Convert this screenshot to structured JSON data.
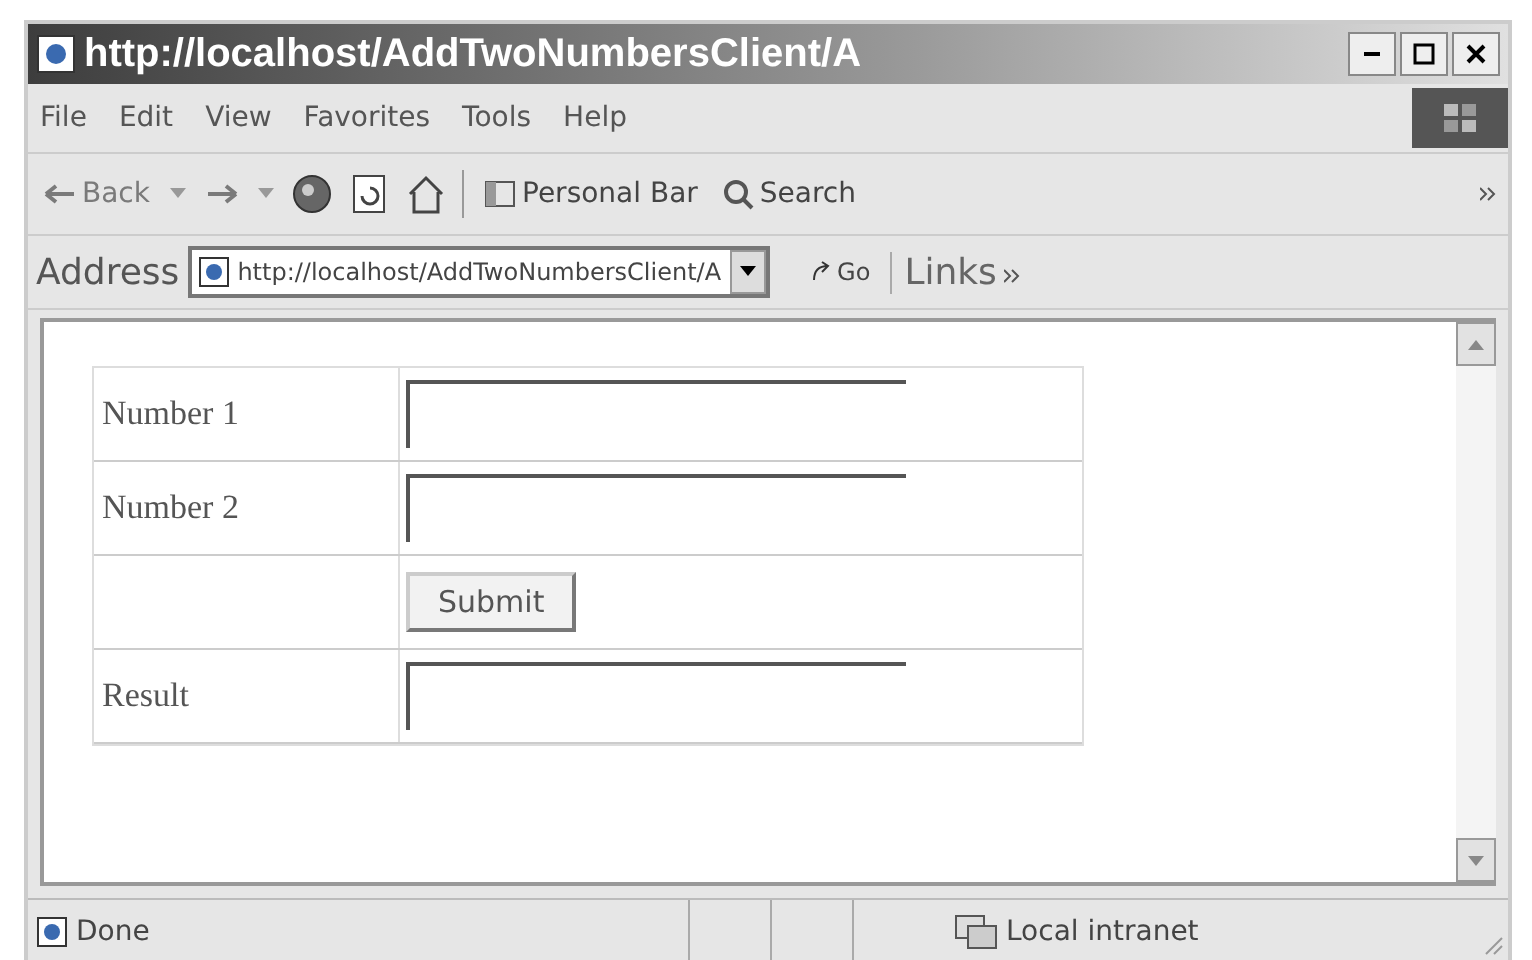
{
  "window": {
    "title": "http://localhost/AddTwoNumbersClient/A"
  },
  "menu": [
    "File",
    "Edit",
    "View",
    "Favorites",
    "Tools",
    "Help"
  ],
  "toolbar": {
    "back": {
      "label": "Back",
      "disabled": true
    },
    "forward": {
      "disabled": true
    },
    "personal_bar": "Personal Bar",
    "search": "Search"
  },
  "address": {
    "label": "Address",
    "value": "http://localhost/AddTwoNumbersClient/A",
    "go": "Go",
    "links": "Links"
  },
  "form": [
    {
      "kind": "field",
      "label": "Number 1"
    },
    {
      "kind": "field",
      "label": "Number 2"
    },
    {
      "kind": "button",
      "label": "Submit"
    },
    {
      "kind": "field",
      "label": "Result"
    }
  ],
  "status_bar": {
    "text": "Done",
    "zone": "Local intranet"
  }
}
